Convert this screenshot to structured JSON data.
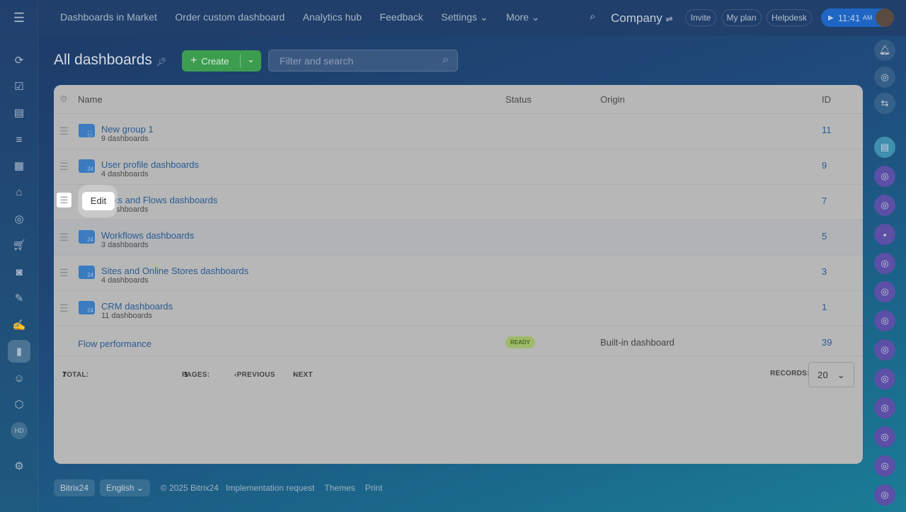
{
  "topnav": {
    "items": [
      "Dashboards in Market",
      "Order custom dashboard",
      "Analytics hub",
      "Feedback",
      "Settings",
      "More"
    ],
    "company": "Company",
    "invite": "Invite",
    "myplan": "My plan",
    "helpdesk": "Helpdesk",
    "time": "11:41",
    "ampm": "AM"
  },
  "page": {
    "title": "All dashboards",
    "create": "Create",
    "search_placeholder": "Filter and search"
  },
  "table": {
    "headers": {
      "name": "Name",
      "status": "Status",
      "origin": "Origin",
      "id": "ID"
    },
    "rows": [
      {
        "name": "New group 1",
        "sub": "9 dashboards",
        "id": "11"
      },
      {
        "name": "User profile dashboards",
        "sub": "4 dashboards",
        "id": "9"
      },
      {
        "name": "ks and Flows dashboards",
        "sub": "shboards",
        "id": "7"
      },
      {
        "name": "Workflows dashboards",
        "sub": "3 dashboards",
        "id": "5"
      },
      {
        "name": "Sites and Online Stores dashboards",
        "sub": "4 dashboards",
        "id": "3"
      },
      {
        "name": "CRM dashboards",
        "sub": "11 dashboards",
        "id": "1"
      }
    ],
    "dashboard": {
      "name": "Flow performance",
      "status": "READY",
      "origin": "Built-in dashboard",
      "id": "39"
    }
  },
  "tooltip": "Edit",
  "pager": {
    "total_label": "TOTAL:",
    "total": "7",
    "pages_label": "PAGES:",
    "pages": "1",
    "prev": "PREVIOUS",
    "next": "NEXT",
    "records_label": "RECORDS:",
    "records": "20"
  },
  "footer": {
    "brand": "Bitrix24",
    "lang": "English",
    "copyright": "© 2025 Bitrix24",
    "impl": "Implementation request",
    "themes": "Themes",
    "print": "Print"
  },
  "sidebar": {
    "avatar": "HD"
  }
}
